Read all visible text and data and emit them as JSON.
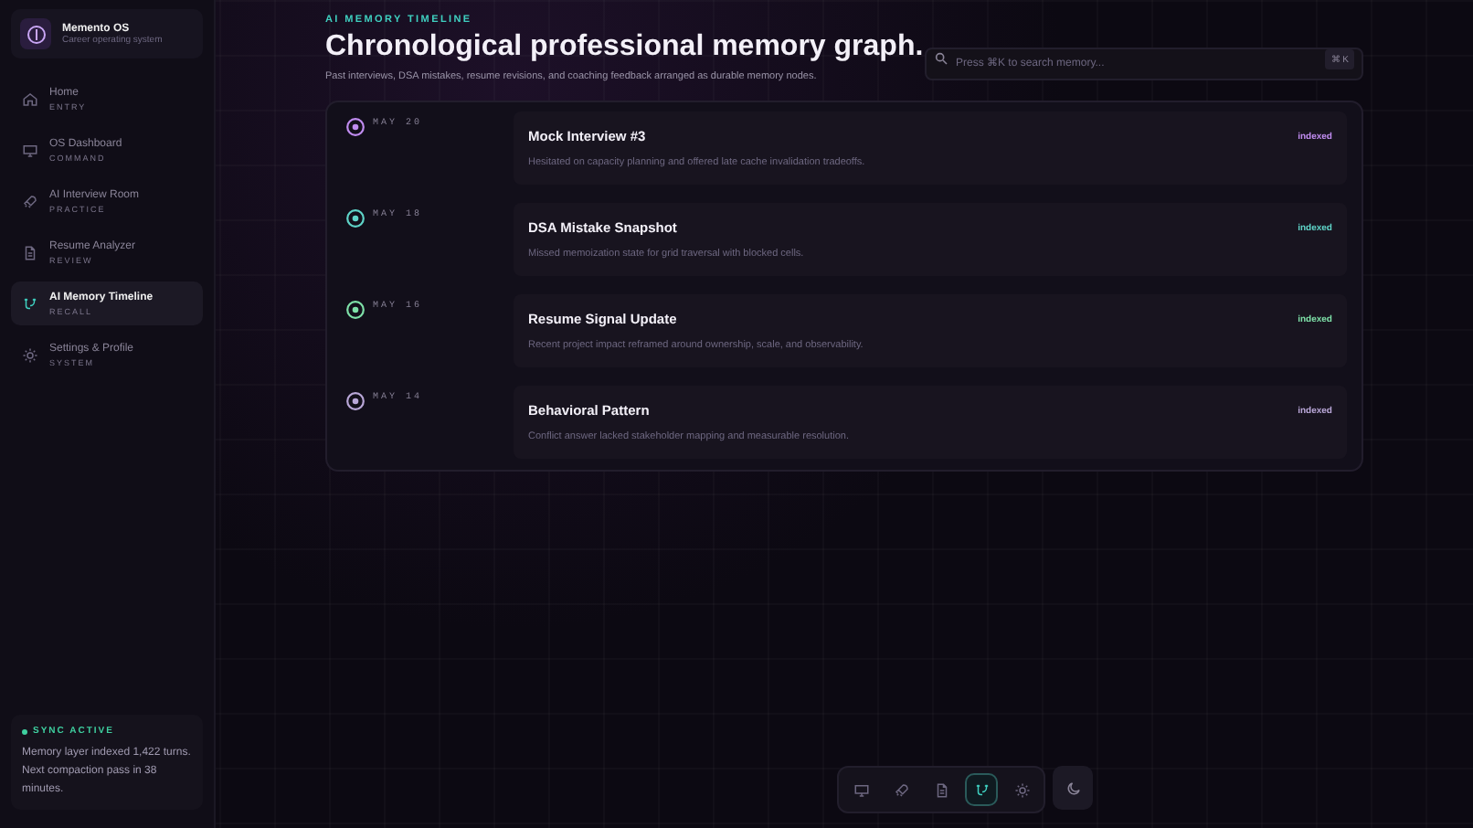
{
  "brand": {
    "name": "Memento OS",
    "tagline": "Career operating system"
  },
  "nav": [
    {
      "label": "Home",
      "sub": "ENTRY",
      "selected": false
    },
    {
      "label": "OS Dashboard",
      "sub": "COMMAND",
      "selected": false
    },
    {
      "label": "AI Interview Room",
      "sub": "PRACTICE",
      "selected": false
    },
    {
      "label": "Resume Analyzer",
      "sub": "REVIEW",
      "selected": false
    },
    {
      "label": "AI Memory Timeline",
      "sub": "RECALL",
      "selected": true
    },
    {
      "label": "Settings & Profile",
      "sub": "SYSTEM",
      "selected": false
    }
  ],
  "sync": {
    "title": "SYNC ACTIVE",
    "text": "Memory layer indexed 1,422 turns. Next compaction pass in 38 minutes."
  },
  "header": {
    "eyebrow": "AI MEMORY TIMELINE",
    "title": "Chronological professional memory graph.",
    "subtitle": "Past interviews, DSA mistakes, resume revisions, and coaching feedback arranged as durable memory nodes."
  },
  "search": {
    "placeholder": "Press ⌘K to search memory...",
    "shortcut": "⌘ K"
  },
  "timeline": [
    {
      "date": "MAY 20",
      "title": "Mock Interview #3",
      "text": "Hesitated on capacity planning and offered late cache invalidation tradeoffs.",
      "badge": "indexed",
      "color": "#c08cf0"
    },
    {
      "date": "MAY 18",
      "title": "DSA Mistake Snapshot",
      "text": "Missed memoization state for grid traversal with blocked cells.",
      "badge": "indexed",
      "color": "#5fd4c8"
    },
    {
      "date": "MAY 16",
      "title": "Resume Signal Update",
      "text": "Recent project impact reframed around ownership, scale, and observability.",
      "badge": "indexed",
      "color": "#7ee0a8"
    },
    {
      "date": "MAY 14",
      "title": "Behavioral Pattern",
      "text": "Conflict answer lacked stakeholder mapping and measurable resolution.",
      "badge": "indexed",
      "color": "#b9a7d8"
    }
  ],
  "dock": [
    {
      "selected": false
    },
    {
      "selected": false
    },
    {
      "selected": false
    },
    {
      "selected": true
    },
    {
      "selected": false
    }
  ]
}
